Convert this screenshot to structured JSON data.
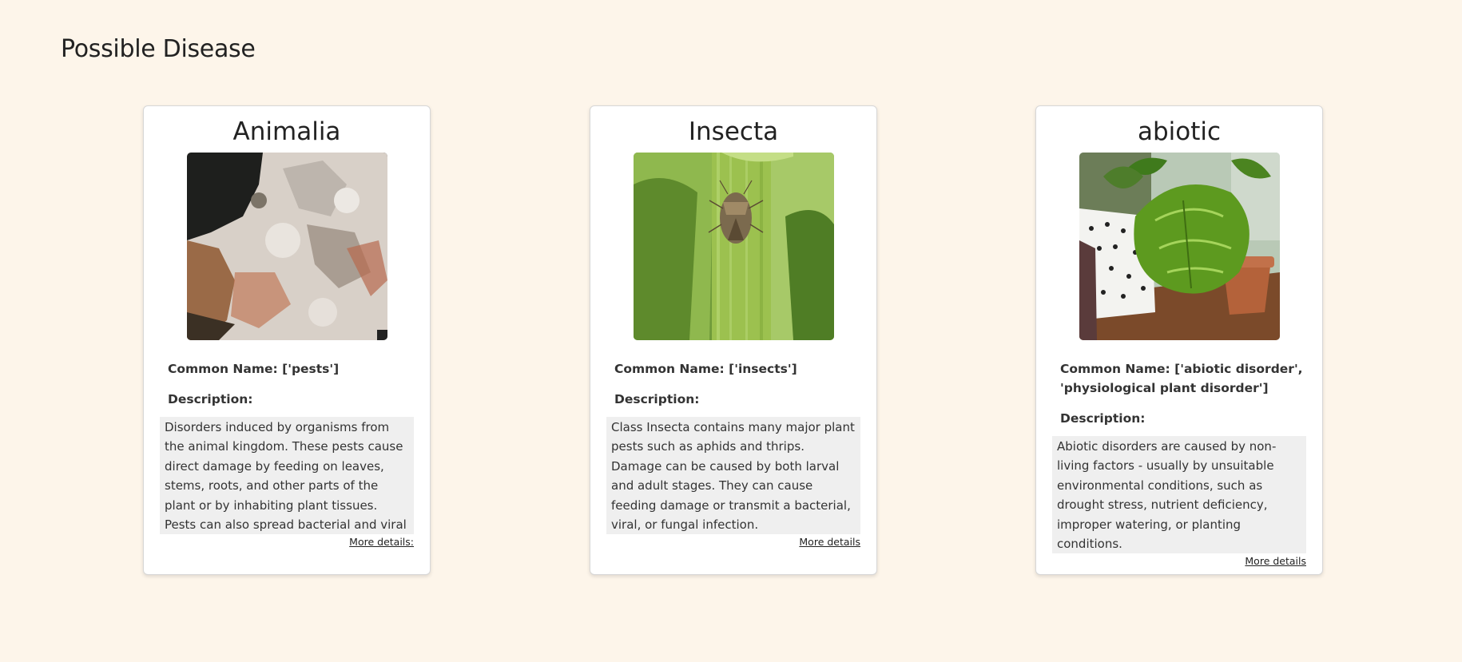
{
  "page": {
    "title": "Possible Disease"
  },
  "cards": [
    {
      "title": "Animalia",
      "common_name_label": "Common Name:",
      "common_name": "['pests']",
      "description_label": "Description:",
      "description": "Disorders induced by organisms from the animal kingdom. These pests cause direct damage by feeding on leaves, stems, roots, and other parts of the plant or by inhabiting plant tissues. Pests can also spread bacterial and viral diseases.",
      "more_link": "More details:"
    },
    {
      "title": "Insecta",
      "common_name_label": "Common Name:",
      "common_name": "['insects']",
      "description_label": "Description:",
      "description": "Class Insecta contains many major plant pests such as aphids and thrips. Damage can be caused by both larval and adult stages. They can cause feeding damage or transmit a bacterial, viral, or fungal infection.",
      "more_link": "More details"
    },
    {
      "title": "abiotic",
      "common_name_label": "Common Name:",
      "common_name": "['abiotic disorder', 'physiological plant disorder']",
      "description_label": "Description:",
      "description": "Abiotic disorders are caused by non-living factors - usually by unsuitable environmental conditions, such as drought stress, nutrient deficiency, improper watering, or planting conditions.",
      "more_link": "More details"
    }
  ],
  "colors": {
    "background": "#fdf5ea",
    "card": "#ffffff",
    "description_box": "#efefef"
  }
}
